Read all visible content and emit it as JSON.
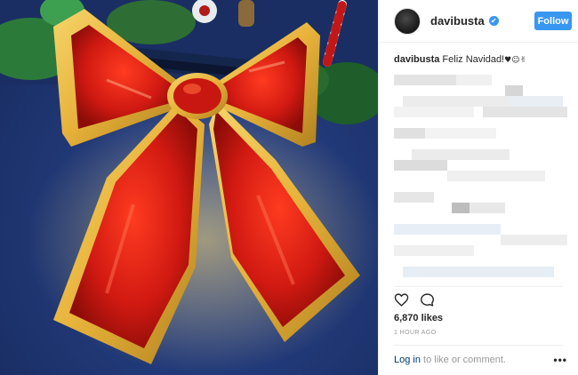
{
  "post": {
    "username": "davibusta",
    "verified_badge": "✔",
    "follow_label": "Follow",
    "caption_user": "davibusta",
    "caption_text": "Feliz Navidad!",
    "caption_emoji": "♥☺✌",
    "likes": "6,870 likes",
    "timestamp": "1 HOUR AGO",
    "login_link": "Log in",
    "login_suffix": " to like or comment.",
    "more_label": "•••"
  },
  "icons": {
    "like": "heart-outline-icon",
    "comment": "speech-bubble-icon",
    "more": "more-options-icon",
    "verified": "verified-badge-icon"
  },
  "colors": {
    "accent": "#3897f0",
    "text": "#262626",
    "muted": "#999999",
    "link": "#003569",
    "bow_red": "#d21a12",
    "bow_gold": "#e7b23a"
  }
}
